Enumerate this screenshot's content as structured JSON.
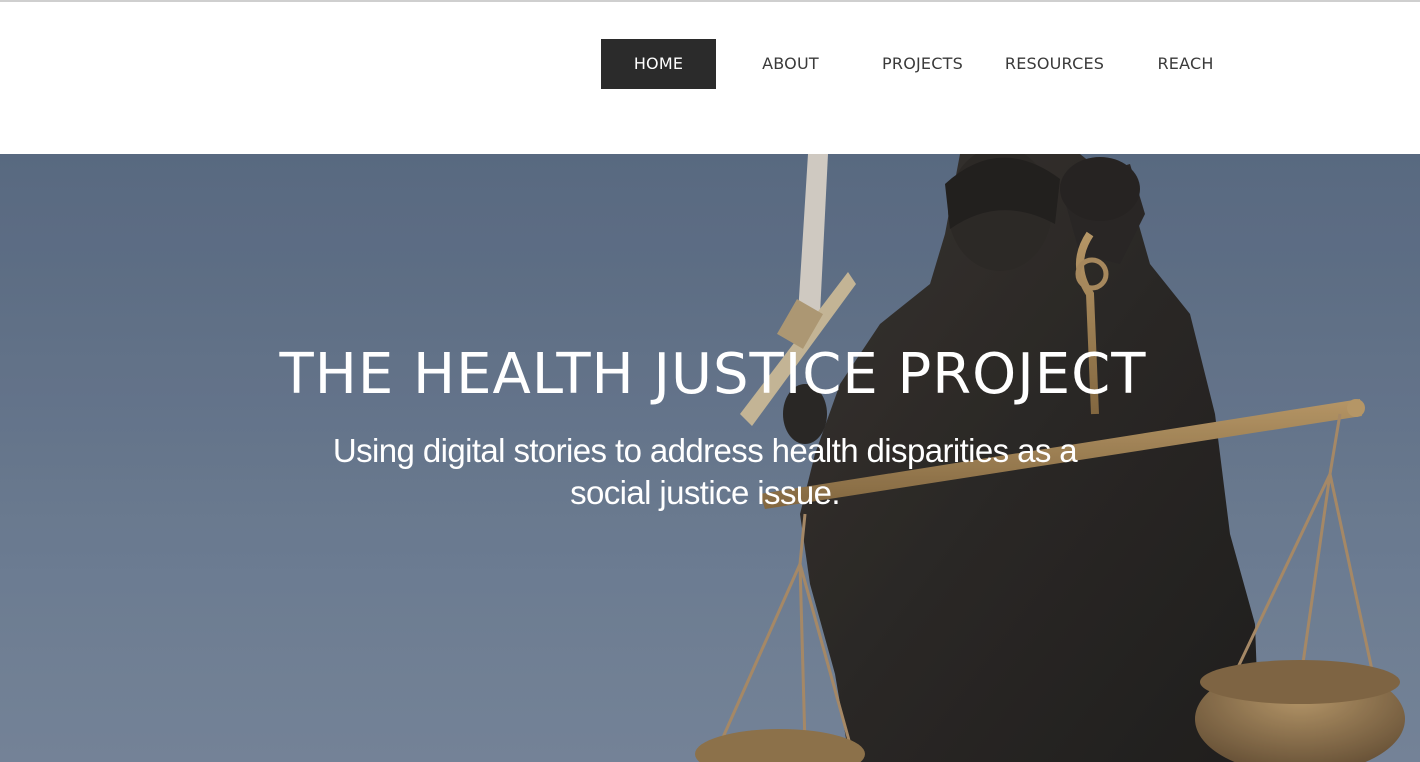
{
  "nav": {
    "items": [
      {
        "label": "HOME",
        "active": true
      },
      {
        "label": "ABOUT",
        "active": false
      },
      {
        "label": "PROJECTS",
        "active": false
      },
      {
        "label": "RESOURCES",
        "active": false
      },
      {
        "label": "REACH",
        "active": false
      }
    ]
  },
  "hero": {
    "title": "THE HEALTH JUSTICE PROJECT",
    "subtitle": "Using digital stories to address health disparities as a social justice issue.",
    "background_image": "lady-justice-statue-with-scales",
    "sky_color": "#6a7b91"
  },
  "colors": {
    "nav_active_bg": "#2b2b2b",
    "nav_text": "#3a3a3a",
    "hero_text": "#ffffff"
  }
}
